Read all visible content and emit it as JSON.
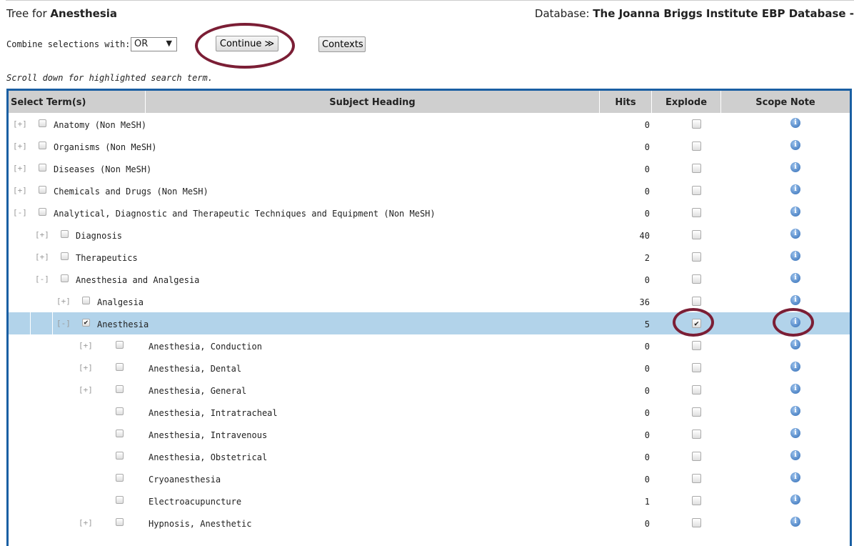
{
  "header": {
    "title_prefix": "Tree for ",
    "title_term": "Anesthesia",
    "db_prefix": "Database: ",
    "db_name": "The Joanna Briggs Institute EBP Database -"
  },
  "controls": {
    "combine_label": "Combine selections with:",
    "combine_value": "OR",
    "continue_label": "Continue ≫",
    "contexts_label": "Contexts"
  },
  "hint": "Scroll down for highlighted search term.",
  "table": {
    "columns": [
      "Select Term(s)",
      "Subject Heading",
      "Hits",
      "Explode",
      "Scope Note"
    ],
    "rows": [
      {
        "expander": "[+]",
        "label": "Anatomy (Non MeSH)",
        "hits": "0",
        "level": 0,
        "checked": false,
        "explode": false,
        "selected": false
      },
      {
        "expander": "[+]",
        "label": "Organisms (Non MeSH)",
        "hits": "0",
        "level": 0,
        "checked": false,
        "explode": false,
        "selected": false
      },
      {
        "expander": "[+]",
        "label": "Diseases (Non MeSH)",
        "hits": "0",
        "level": 0,
        "checked": false,
        "explode": false,
        "selected": false
      },
      {
        "expander": "[+]",
        "label": "Chemicals and Drugs (Non MeSH)",
        "hits": "0",
        "level": 0,
        "checked": false,
        "explode": false,
        "selected": false
      },
      {
        "expander": "[-]",
        "label": "Analytical, Diagnostic and Therapeutic Techniques and Equipment (Non MeSH)",
        "hits": "0",
        "level": 0,
        "checked": false,
        "explode": false,
        "selected": false
      },
      {
        "expander": "[+]",
        "label": "Diagnosis",
        "hits": "40",
        "level": 1,
        "checked": false,
        "explode": false,
        "selected": false
      },
      {
        "expander": "[+]",
        "label": "Therapeutics",
        "hits": "2",
        "level": 1,
        "checked": false,
        "explode": false,
        "selected": false
      },
      {
        "expander": "[-]",
        "label": "Anesthesia and Analgesia",
        "hits": "0",
        "level": 1,
        "checked": false,
        "explode": false,
        "selected": false
      },
      {
        "expander": "[+]",
        "label": "Analgesia",
        "hits": "36",
        "level": 2,
        "checked": false,
        "explode": false,
        "selected": false
      },
      {
        "expander": "[-]",
        "label": "Anesthesia",
        "hits": "5",
        "level": 2,
        "checked": true,
        "explode": true,
        "selected": true
      },
      {
        "expander": "[+]",
        "label": "Anesthesia, Conduction",
        "hits": "0",
        "level": 3,
        "checked": false,
        "explode": false,
        "selected": false
      },
      {
        "expander": "[+]",
        "label": "Anesthesia, Dental",
        "hits": "0",
        "level": 3,
        "checked": false,
        "explode": false,
        "selected": false
      },
      {
        "expander": "[+]",
        "label": "Anesthesia, General",
        "hits": "0",
        "level": 3,
        "checked": false,
        "explode": false,
        "selected": false
      },
      {
        "expander": "",
        "label": "Anesthesia, Intratracheal",
        "hits": "0",
        "level": 3,
        "checked": false,
        "explode": false,
        "selected": false
      },
      {
        "expander": "",
        "label": "Anesthesia, Intravenous",
        "hits": "0",
        "level": 3,
        "checked": false,
        "explode": false,
        "selected": false
      },
      {
        "expander": "",
        "label": "Anesthesia, Obstetrical",
        "hits": "0",
        "level": 3,
        "checked": false,
        "explode": false,
        "selected": false
      },
      {
        "expander": "",
        "label": "Cryoanesthesia",
        "hits": "0",
        "level": 3,
        "checked": false,
        "explode": false,
        "selected": false
      },
      {
        "expander": "",
        "label": "Electroacupuncture",
        "hits": "1",
        "level": 3,
        "checked": false,
        "explode": false,
        "selected": false
      },
      {
        "expander": "[+]",
        "label": "Hypnosis, Anesthetic",
        "hits": "0",
        "level": 3,
        "checked": false,
        "explode": false,
        "selected": false
      }
    ]
  },
  "icons": {
    "scope_note": "info-icon",
    "check": "✔"
  },
  "colors": {
    "highlight_row": "#b2d3ea",
    "table_border": "#1a5fa3",
    "annotation_circle": "#7b1e35",
    "header_bg": "#cfcfcf"
  }
}
